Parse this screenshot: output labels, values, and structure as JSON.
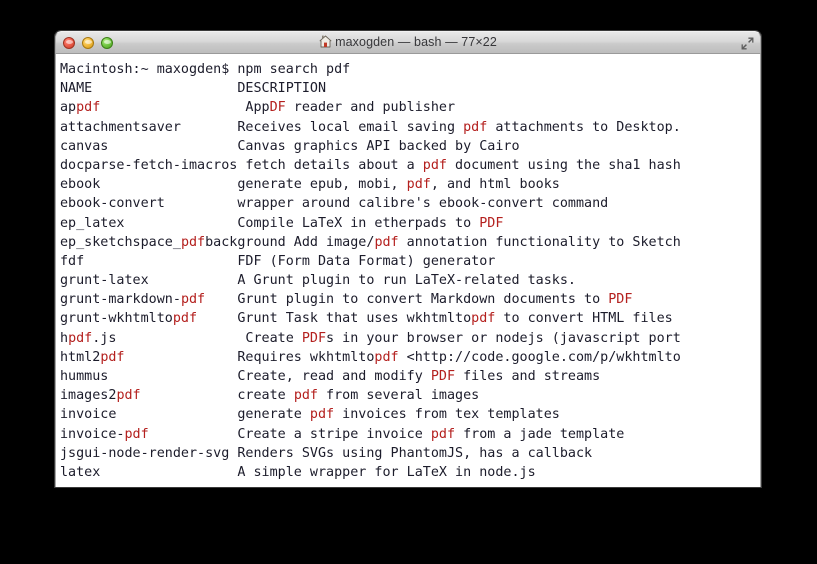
{
  "window": {
    "title": "maxogden — bash — 77×22",
    "title_icon": "house-icon",
    "buttons": {
      "close": "close-button",
      "minimize": "minimize-button",
      "maximize": "maximize-button",
      "fullscreen": "fullscreen-button"
    },
    "colors": {
      "close": "#ee5f4d",
      "minimize": "#f4bd3f",
      "maximize": "#74c944",
      "titlebar": "#d8d8d8",
      "terminal_bg": "#ffffff",
      "terminal_fg": "#1c1c2b",
      "match_highlight": "#b4201e",
      "desktop_bg": "#000000"
    }
  },
  "terminal": {
    "prompt": "Macintosh:~ maxogden$ ",
    "command": "npm search pdf",
    "columns": 77,
    "rows": 22,
    "headers": {
      "name": "NAME",
      "description": "DESCRIPTION"
    },
    "lines": [
      [
        {
          "t": "Macintosh:~ maxogden$ npm search pdf",
          "h": false
        }
      ],
      [
        {
          "t": "NAME                  DESCRIPTION",
          "h": false
        }
      ],
      [
        {
          "t": "ap",
          "h": false
        },
        {
          "t": "pdf",
          "h": true
        },
        {
          "t": "                  App",
          "h": false
        },
        {
          "t": "DF",
          "h": true
        },
        {
          "t": " reader and publisher",
          "h": false
        }
      ],
      [
        {
          "t": "attachmentsaver       Receives local email saving ",
          "h": false
        },
        {
          "t": "pdf",
          "h": true
        },
        {
          "t": " attachments to Desktop.",
          "h": false
        }
      ],
      [
        {
          "t": "canvas                Canvas graphics API backed by Cairo",
          "h": false
        }
      ],
      [
        {
          "t": "docparse-fetch-imacros fetch details about a ",
          "h": false
        },
        {
          "t": "pdf",
          "h": true
        },
        {
          "t": " document using the sha1 hash",
          "h": false
        }
      ],
      [
        {
          "t": "ebook                 generate epub, mobi, ",
          "h": false
        },
        {
          "t": "pdf",
          "h": true
        },
        {
          "t": ", and html books",
          "h": false
        }
      ],
      [
        {
          "t": "ebook-convert         wrapper around calibre's ebook-convert command",
          "h": false
        }
      ],
      [
        {
          "t": "ep_latex              Compile LaTeX in etherpads to ",
          "h": false
        },
        {
          "t": "PDF",
          "h": true
        }
      ],
      [
        {
          "t": "ep_sketchspace_",
          "h": false
        },
        {
          "t": "pdf",
          "h": true
        },
        {
          "t": "background Add image/",
          "h": false
        },
        {
          "t": "pdf",
          "h": true
        },
        {
          "t": " annotation functionality to Sketch",
          "h": false
        }
      ],
      [
        {
          "t": "fdf                   FDF (Form Data Format) generator",
          "h": false
        }
      ],
      [
        {
          "t": "grunt-latex           A Grunt plugin to run LaTeX-related tasks.",
          "h": false
        }
      ],
      [
        {
          "t": "grunt-markdown-",
          "h": false
        },
        {
          "t": "pdf",
          "h": true
        },
        {
          "t": "    Grunt plugin to convert Markdown documents to ",
          "h": false
        },
        {
          "t": "PDF",
          "h": true
        }
      ],
      [
        {
          "t": "grunt-wkhtmlto",
          "h": false
        },
        {
          "t": "pdf",
          "h": true
        },
        {
          "t": "     Grunt Task that uses wkhtmlto",
          "h": false
        },
        {
          "t": "pdf",
          "h": true
        },
        {
          "t": " to convert HTML files",
          "h": false
        }
      ],
      [
        {
          "t": "h",
          "h": false
        },
        {
          "t": "pdf",
          "h": true
        },
        {
          "t": ".js                Create ",
          "h": false
        },
        {
          "t": "PDF",
          "h": true
        },
        {
          "t": "s in your browser or nodejs (javascript port",
          "h": false
        }
      ],
      [
        {
          "t": "html2",
          "h": false
        },
        {
          "t": "pdf",
          "h": true
        },
        {
          "t": "              Requires wkhtmlto",
          "h": false
        },
        {
          "t": "pdf",
          "h": true
        },
        {
          "t": " <http://code.google.com/p/wkhtmlto",
          "h": false
        }
      ],
      [
        {
          "t": "hummus                Create, read and modify ",
          "h": false
        },
        {
          "t": "PDF",
          "h": true
        },
        {
          "t": " files and streams",
          "h": false
        }
      ],
      [
        {
          "t": "images2",
          "h": false
        },
        {
          "t": "pdf",
          "h": true
        },
        {
          "t": "            create ",
          "h": false
        },
        {
          "t": "pdf",
          "h": true
        },
        {
          "t": " from several images",
          "h": false
        }
      ],
      [
        {
          "t": "invoice               generate ",
          "h": false
        },
        {
          "t": "pdf",
          "h": true
        },
        {
          "t": " invoices from tex templates",
          "h": false
        }
      ],
      [
        {
          "t": "invoice-",
          "h": false
        },
        {
          "t": "pdf",
          "h": true
        },
        {
          "t": "           Create a stripe invoice ",
          "h": false
        },
        {
          "t": "pdf",
          "h": true
        },
        {
          "t": " from a jade template",
          "h": false
        }
      ],
      [
        {
          "t": "jsgui-node-render-svg Renders SVGs using PhantomJS, has a callback",
          "h": false
        }
      ],
      [
        {
          "t": "latex                 A simple wrapper for LaTeX in node.js",
          "h": false
        }
      ]
    ]
  }
}
